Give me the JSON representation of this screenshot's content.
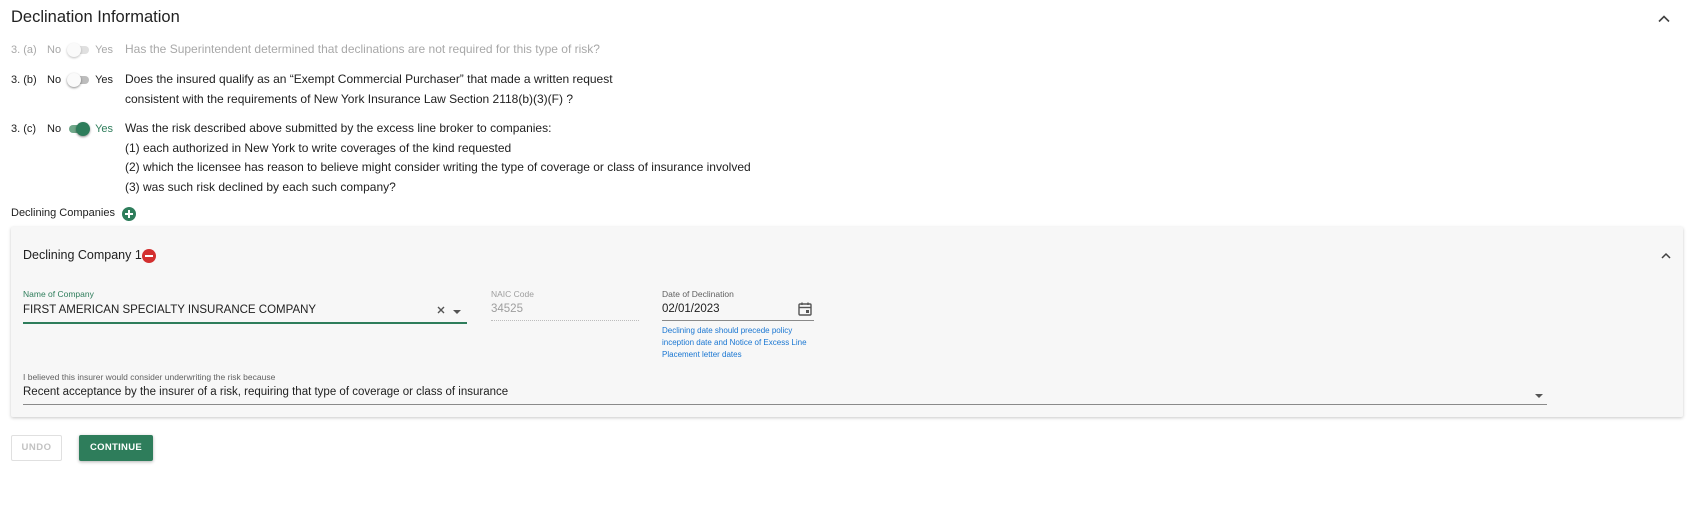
{
  "section": {
    "title": "Declination Information"
  },
  "questions": [
    {
      "num": "3. (a)",
      "no_label": "No",
      "yes_label": "Yes",
      "value": "No",
      "enabled": false,
      "text": "Has the Superintendent determined that declinations are not required for this type of risk?"
    },
    {
      "num": "3. (b)",
      "no_label": "No",
      "yes_label": "Yes",
      "value": "No",
      "enabled": true,
      "lines": [
        "Does the insured qualify as an “Exempt Commercial Purchaser” that made a written request",
        "consistent with the requirements of New York Insurance Law Section 2118(b)(3)(F) ?"
      ]
    },
    {
      "num": "3. (c)",
      "no_label": "No",
      "yes_label": "Yes",
      "value": "Yes",
      "enabled": true,
      "lines": [
        "Was the risk described above submitted by the excess line broker to companies:",
        "(1) each authorized in New York to write coverages of the kind requested",
        "(2) which the licensee has reason to believe might consider writing the type of coverage or class of insurance involved",
        "(3) was such risk declined by each such company?"
      ]
    }
  ],
  "declining": {
    "label": "Declining Companies",
    "add_icon": "plus-circle-icon",
    "companies": [
      {
        "title": "Declining Company 1",
        "remove_icon": "minus-circle-icon",
        "name_label": "Name of Company",
        "name_value": "FIRST AMERICAN SPECIALTY INSURANCE COMPANY",
        "naic_label": "NAIC Code",
        "naic_value": "34525",
        "date_label": "Date of Declination",
        "date_value": "02/01/2023",
        "date_hint": "Declining date should precede policy inception date and Notice of Excess Line Placement letter dates",
        "reason_label": "I believed this insurer would consider underwriting the risk because",
        "reason_value": "Recent acceptance by the insurer of a risk, requiring that type of coverage or class of insurance"
      }
    ]
  },
  "actions": {
    "undo": "UNDO",
    "continue": "CONTINUE"
  },
  "colors": {
    "accent": "#2e7d5b",
    "danger": "#d32f2f",
    "hint": "#1976d2"
  }
}
